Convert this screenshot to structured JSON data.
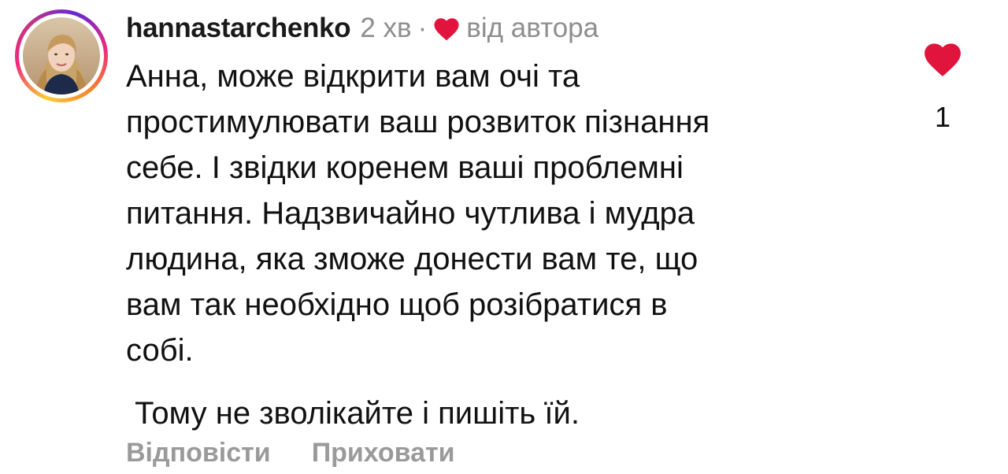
{
  "comment": {
    "username": "hannastarchenko",
    "time": "2 хв",
    "separator": "·",
    "author_badge_label": "від автора",
    "author_badge_icon": "heart-icon",
    "author_badge_color": "#e0143c",
    "text_paragraph_1": "Анна, може відкрити вам очі та\nпростимулювати ваш розвиток пізнання\nсебе.  І звідки коренем ваші проблемні\nпитання. Надзвичайно чутлива і мудра\nлюдина, яка зможе донести вам те, що\nвам так необхідно щоб розібратися в\nсобі.",
    "text_paragraph_2": " Тому не зволікайте і пишіть їй.",
    "actions": {
      "reply_label": "Відповісти",
      "hide_label": "Приховати"
    },
    "likes": {
      "icon": "heart-icon",
      "liked": true,
      "color": "#e0143c",
      "count": "1"
    }
  },
  "colors": {
    "story_ring": [
      "#f9ce34",
      "#ee2a7b",
      "#6228d7"
    ],
    "meta_gray": "#8e8e8e",
    "action_gray": "#9a9a9a"
  }
}
